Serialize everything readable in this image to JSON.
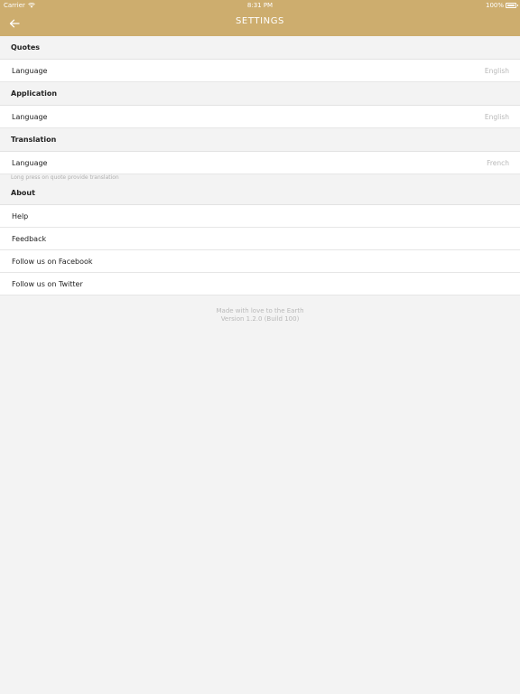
{
  "status_bar": {
    "carrier": "Carrier",
    "time": "8:31 PM",
    "battery": "100%"
  },
  "nav": {
    "title": "SETTINGS",
    "back_icon": "arrow-left-icon"
  },
  "colors": {
    "accent": "#cdad6e",
    "background": "#f3f3f3"
  },
  "sections": {
    "quotes": {
      "title": "Quotes",
      "language_label": "Language",
      "language_value": "English"
    },
    "application": {
      "title": "Application",
      "language_label": "Language",
      "language_value": "English"
    },
    "translation": {
      "title": "Translation",
      "language_label": "Language",
      "language_value": "French",
      "hint": "Long press on quote provide translation"
    },
    "about": {
      "title": "About",
      "help": "Help",
      "feedback": "Feedback",
      "facebook": "Follow us on Facebook",
      "twitter": "Follow us on Twitter"
    }
  },
  "footer": {
    "line1": "Made with love to the Earth",
    "line2": "Version 1.2.0 (Build 100)"
  }
}
